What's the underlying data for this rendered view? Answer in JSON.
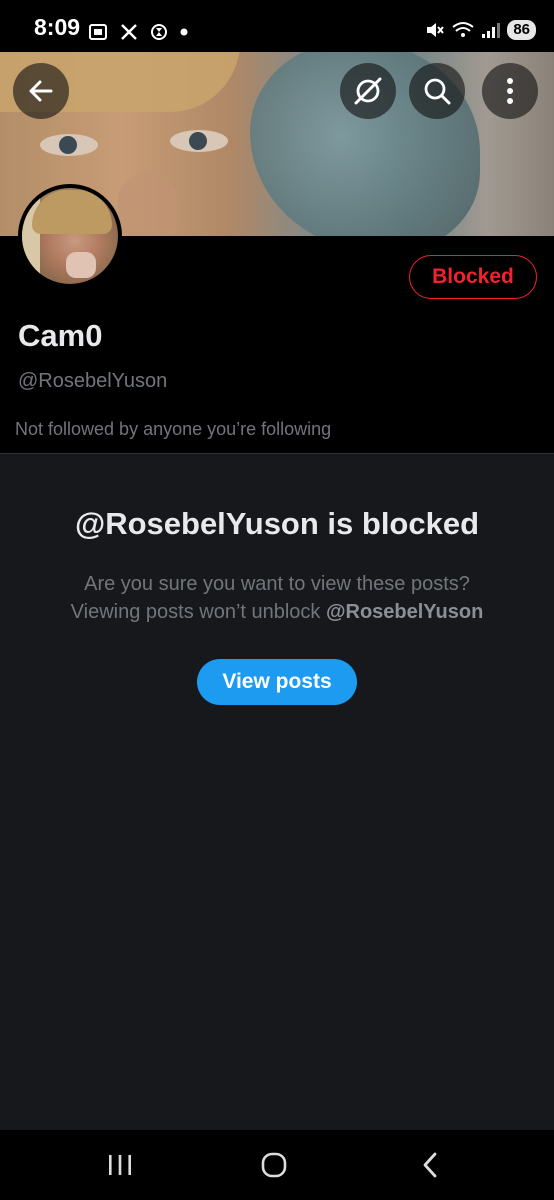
{
  "status_bar": {
    "time": "8:09",
    "left_icons": [
      "screenshot-icon",
      "x-logo-icon",
      "timer-icon",
      "notification-dot-icon"
    ],
    "right_icons": [
      "mute-icon",
      "wifi-icon",
      "signal-icon"
    ],
    "battery": "86"
  },
  "header": {
    "buttons": [
      "back-arrow-icon",
      "grok-icon",
      "search-icon",
      "more-vertical-icon"
    ]
  },
  "profile": {
    "display_name": "Cam0",
    "handle": "@RosebelYuson",
    "follow_note": "Not followed by anyone you’re following",
    "blocked_label": "Blocked"
  },
  "notice": {
    "title": "@RosebelYuson is blocked",
    "line1": "Are you sure you want to view these posts?",
    "line2_prefix": "Viewing posts won’t unblock ",
    "line2_handle": "@RosebelYuson",
    "button_label": "View posts"
  },
  "nav_bar": {
    "buttons": [
      "recent-apps-icon",
      "home-icon",
      "back-icon"
    ]
  },
  "colors": {
    "background": "#16181c",
    "header_background": "#000000",
    "blocked_red": "#f4212e",
    "primary_blue": "#1d9bf0",
    "secondary_text": "#71767b"
  }
}
